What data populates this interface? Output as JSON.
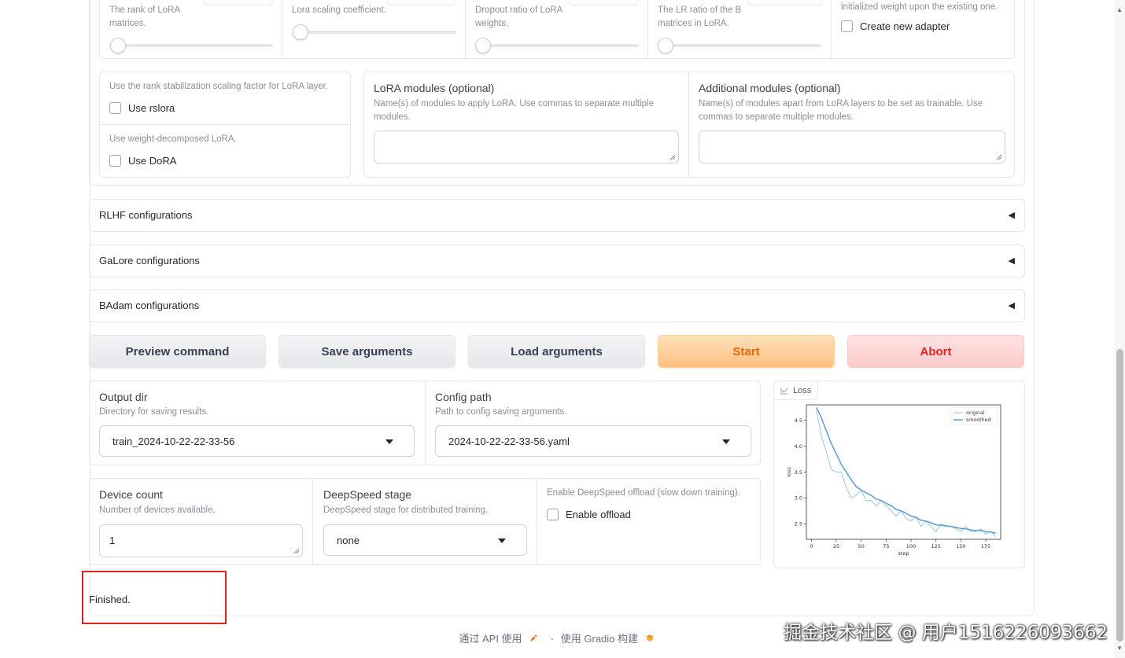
{
  "lora_row1": {
    "rank_info": "The rank of LoRA matrices.",
    "alpha_info": "Lora scaling coefficient.",
    "dropout_info": "Dropout ratio of LoRA weights.",
    "ratio_info": "The LR ratio of the B matrices in LoRA.",
    "adapter_info": "initialized weight upon the existing one.",
    "create_new_adapter": "Create new adapter"
  },
  "lora_row2": {
    "rslora_info": "Use the rank stabilization scaling factor for LoRA layer.",
    "rslora_label": "Use rslora",
    "dora_info": "Use weight-decomposed LoRA.",
    "dora_label": "Use DoRA",
    "lora_modules_label": "LoRA modules (optional)",
    "lora_modules_info": "Name(s) of modules to apply LoRA. Use commas to separate multiple modules.",
    "additional_modules_label": "Additional modules (optional)",
    "additional_modules_info": "Name(s) of modules apart from LoRA layers to be set as trainable. Use commas to separate multiple modules."
  },
  "accordions": {
    "rlhf": "RLHF configurations",
    "galore": "GaLore configurations",
    "badam": "BAdam configurations",
    "arrow": "◀"
  },
  "buttons": {
    "preview": "Preview command",
    "save": "Save arguments",
    "load": "Load arguments",
    "start": "Start",
    "abort": "Abort"
  },
  "output": {
    "output_dir_label": "Output dir",
    "output_dir_info": "Directory for saving results.",
    "output_dir_value": "train_2024-10-22-22-33-56",
    "config_path_label": "Config path",
    "config_path_info": "Path to config saving arguments.",
    "config_path_value": "2024-10-22-22-33-56.yaml"
  },
  "device": {
    "count_label": "Device count",
    "count_info": "Number of devices available.",
    "count_value": "1",
    "ds_label": "DeepSpeed stage",
    "ds_info": "DeepSpeed stage for distributed training.",
    "ds_value": "none",
    "offload_info": "Enable DeepSpeed offload (slow down training).",
    "offload_label": "Enable offload"
  },
  "plot_panel": {
    "tab_label": "Loss"
  },
  "status": {
    "text": "Finished."
  },
  "footer": {
    "api": "通过 API 使用",
    "sep": "·",
    "built": "使用 Gradio 构建"
  },
  "watermark": "掘金技术社区 @ 用户1516226093662",
  "colors": {
    "start": "#e8650a",
    "abort": "#dc2626",
    "original": "#a8c8e0",
    "smoothed": "#5b9ec9"
  },
  "chart_data": {
    "type": "line",
    "title": "",
    "xlabel": "step",
    "ylabel": "loss",
    "xlim": [
      -5,
      190
    ],
    "ylim": [
      2.2,
      4.8
    ],
    "xticks": [
      0,
      25,
      50,
      75,
      100,
      125,
      150,
      175
    ],
    "yticks": [
      2.5,
      3.0,
      3.5,
      4.0,
      4.5
    ],
    "legend": "top-right",
    "series": [
      {
        "name": "original",
        "x": [
          5,
          10,
          15,
          20,
          25,
          30,
          35,
          40,
          45,
          50,
          55,
          60,
          65,
          70,
          75,
          80,
          85,
          90,
          95,
          100,
          105,
          110,
          115,
          120,
          125,
          130,
          135,
          140,
          145,
          150,
          155,
          160,
          165,
          170,
          175,
          180,
          185
        ],
        "values": [
          4.7,
          4.2,
          3.9,
          3.55,
          3.5,
          3.5,
          3.2,
          3.0,
          3.05,
          3.15,
          2.95,
          2.95,
          2.85,
          2.95,
          2.85,
          2.75,
          2.65,
          2.75,
          2.6,
          2.55,
          2.65,
          2.45,
          2.55,
          2.45,
          2.35,
          2.5,
          2.45,
          2.45,
          2.4,
          2.35,
          2.45,
          2.35,
          2.35,
          2.4,
          2.3,
          2.35,
          2.25
        ]
      },
      {
        "name": "smoothed",
        "x": [
          5,
          10,
          15,
          20,
          25,
          30,
          35,
          40,
          45,
          50,
          55,
          60,
          65,
          70,
          75,
          80,
          85,
          90,
          95,
          100,
          105,
          110,
          115,
          120,
          125,
          130,
          135,
          140,
          145,
          150,
          155,
          160,
          165,
          170,
          175,
          180,
          185
        ],
        "values": [
          4.75,
          4.55,
          4.3,
          4.05,
          3.85,
          3.65,
          3.5,
          3.35,
          3.22,
          3.15,
          3.1,
          3.05,
          2.98,
          2.95,
          2.9,
          2.85,
          2.78,
          2.75,
          2.7,
          2.65,
          2.62,
          2.57,
          2.55,
          2.52,
          2.48,
          2.47,
          2.46,
          2.45,
          2.43,
          2.41,
          2.4,
          2.38,
          2.37,
          2.37,
          2.35,
          2.34,
          2.32
        ]
      }
    ]
  }
}
